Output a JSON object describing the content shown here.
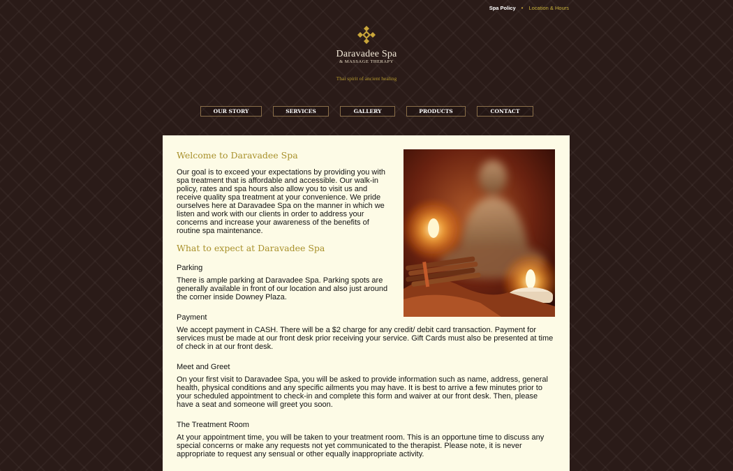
{
  "toplinks": {
    "spa_policy": "Spa Policy",
    "separator": "•",
    "location_hours": "Location & Hours"
  },
  "logo": {
    "icon": "diamond-ornament-icon",
    "name": "Daravadee Spa",
    "subtitle": "& MASSAGE THERAPY",
    "tagline": "Thai spirit of ancient healing"
  },
  "nav": {
    "items": [
      {
        "label": "OUR STORY"
      },
      {
        "label": "SERVICES"
      },
      {
        "label": "GALLERY"
      },
      {
        "label": "PRODUCTS"
      },
      {
        "label": "CONTACT"
      }
    ]
  },
  "main": {
    "welcome_heading": "Welcome to Daravadee Spa",
    "intro": "Our goal is to exceed your expectations by providing you with spa treatment that is affordable and accessible. Our walk-in policy, rates and spa hours also allow you to visit us and receive quality spa treatment at your convenience. We pride ourselves here at Daravadee Spa on the manner in which we listen and work with our clients in order to address your concerns and increase your awareness of the benefits of routine spa maintenance.",
    "expect_heading": "What to expect at Daravadee Spa",
    "sections": [
      {
        "title": "Parking",
        "text": "There is ample parking at Daravadee Spa. Parking spots are generally available in front of our location and also just around the corner inside Downey Plaza."
      },
      {
        "title": "Payment",
        "text": "We accept payment in CASH. There will be a $2 charge for any credit/ debit card transaction. Payment for services must be made at our front desk prior receiving your service. Gift Cards must also be presented at time of check in at our front desk."
      },
      {
        "title": "Meet and Greet",
        "text": "On your first visit to Daravadee Spa, you will be asked to provide information such as name, address, general health, physical conditions and any specific ailments you may have. It is best to arrive a few minutes prior to your scheduled appointment to check-in and complete this form and waiver at our front desk. Then, please have a seat and someone will greet you soon."
      },
      {
        "title": "The Treatment Room",
        "text": "At your appointment time, you will be taken to your treatment room. This is an opportune time to discuss any special concerns or make any requests not yet communicated to the therapist. Please note, it is never appropriate to request any sensual or other equally inappropriate activity."
      }
    ]
  },
  "colors": {
    "background": "#2a1b18",
    "content_bg": "#fdfbe6",
    "heading_gold": "#a8902a",
    "nav_border": "#8a6f4a"
  }
}
